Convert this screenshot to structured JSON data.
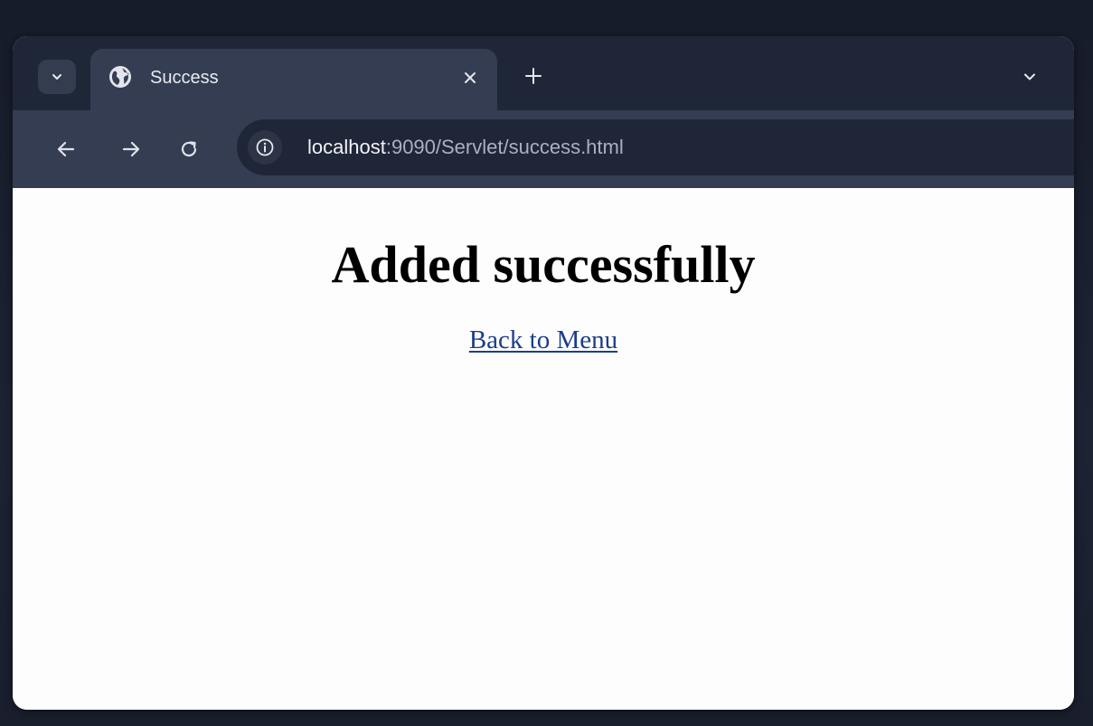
{
  "browser": {
    "tab": {
      "title": "Success",
      "favicon": "globe-icon"
    },
    "address_bar": {
      "host": "localhost",
      "path": ":9090/Servlet/success.html"
    },
    "icons": {
      "tab_search": "chevron-down-icon",
      "tab_close": "close-icon",
      "new_tab": "plus-icon",
      "tab_list": "chevron-down-icon",
      "back": "arrow-left-icon",
      "forward": "arrow-right-icon",
      "reload": "reload-icon",
      "site_info": "info-icon"
    },
    "colors": {
      "frame": "#1f2638",
      "toolbar": "#353d52",
      "link": "#1a3e8a"
    }
  },
  "page": {
    "heading": "Added successfully",
    "link_text": "Back to Menu"
  }
}
